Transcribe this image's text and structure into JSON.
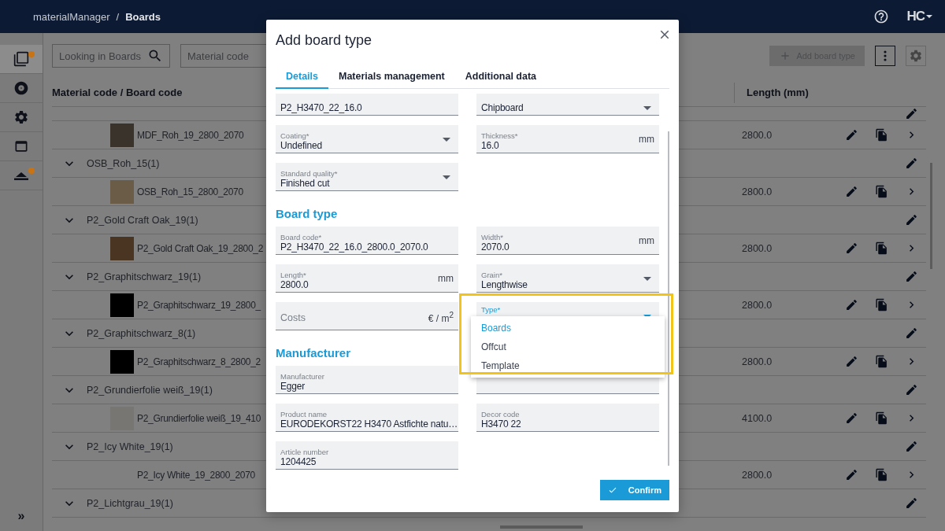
{
  "top_bar": {
    "app": "materialManager",
    "separator": "/",
    "page": "Boards",
    "logo": "HC"
  },
  "sidebar": {
    "items": [
      {
        "selected": true,
        "notification": true
      },
      {
        "selected": false,
        "notification": false
      },
      {
        "selected": false,
        "notification": false
      },
      {
        "selected": false,
        "notification": false
      },
      {
        "selected": false,
        "notification": true
      }
    ],
    "expand": "»"
  },
  "toolbar": {
    "search": {
      "placeholder": "Looking in Boards"
    },
    "filter": {
      "placeholder": "Material code"
    },
    "add_button": {
      "label": "Add board type",
      "disabled": true
    }
  },
  "table": {
    "columns": [
      "Material code / Board code",
      "Length (mm)"
    ],
    "rows": [
      {
        "kind": "partial"
      },
      {
        "kind": "board",
        "name": "MDF_Roh_19_2800_2070",
        "length": "2800.0",
        "color": "#3a332c"
      },
      {
        "kind": "group",
        "name": "OSB_Roh_15(1)",
        "expanded": true
      },
      {
        "kind": "board",
        "name": "OSB_Roh_15_2800_2070",
        "length": "2800.0",
        "color": "#6b5c48"
      },
      {
        "kind": "group",
        "name": "P2_Gold Craft Oak_19(1)",
        "expanded": true
      },
      {
        "kind": "board",
        "name": "P2_Gold Craft Oak_19_2800_2",
        "length": "2800.0",
        "color": "#4a3522"
      },
      {
        "kind": "group",
        "name": "P2_Graphitschwarz_19(1)",
        "expanded": true
      },
      {
        "kind": "board",
        "name": "P2_Graphitschwarz_19_2800_",
        "length": "2800.0",
        "color": "#000000"
      },
      {
        "kind": "group",
        "name": "P2_Graphitschwarz_8(1)",
        "expanded": true
      },
      {
        "kind": "board",
        "name": "P2_Graphitschwarz_8_2800_2",
        "length": "2800.0",
        "color": "#000000"
      },
      {
        "kind": "group",
        "name": "P2_Grundierfolie weiß_19(1)",
        "expanded": true
      },
      {
        "kind": "board",
        "name": "P2_Grundierfolie weiß_19_410",
        "length": "4100.0",
        "color": "#777673"
      },
      {
        "kind": "group",
        "name": "P2_Icy White_19(1)",
        "expanded": true
      },
      {
        "kind": "board",
        "name": "P2_Icy White_19_2800_2070",
        "length": "2800.0"
      },
      {
        "kind": "group",
        "name": "P2_Lichtgrau_19(1)",
        "expanded": true
      }
    ]
  },
  "dialog": {
    "title": "Add board type",
    "tabs": [
      {
        "label": "Details",
        "selected": true
      },
      {
        "label": "Materials management",
        "selected": false
      },
      {
        "label": "Additional data",
        "selected": false
      }
    ],
    "sections": [
      {
        "rows": [
          [
            {
              "kind": "text",
              "value": "P2_H3470_22_16.0"
            },
            {
              "kind": "select",
              "value": "Chipboard"
            }
          ],
          [
            {
              "kind": "select",
              "label": "Coating*",
              "value": "Undefined"
            },
            {
              "kind": "text",
              "label": "Thickness*",
              "value": "16.0",
              "unit": "mm"
            }
          ],
          [
            {
              "kind": "select",
              "label": "Standard quality*",
              "value": "Finished cut"
            }
          ]
        ]
      },
      {
        "heading": "Board type",
        "rows": [
          [
            {
              "kind": "text",
              "label": "Board code*",
              "value": "P2_H3470_22_16.0_2800.0_2070.0"
            },
            {
              "kind": "text",
              "label": "Width*",
              "value": "2070.0",
              "unit": "mm"
            }
          ],
          [
            {
              "kind": "text",
              "label": "Length*",
              "value": "2800.0",
              "unit": "mm"
            },
            {
              "kind": "select",
              "label": "Grain*",
              "value": "Lengthwise"
            }
          ],
          [
            {
              "kind": "text",
              "placeholder": "Costs",
              "unit": "€ / m$^{2}$"
            },
            {
              "kind": "select",
              "label": "Type*",
              "open": true,
              "highlighted": true,
              "options": [
                {
                  "label": "Boards",
                  "selected": true
                },
                {
                  "label": "Offcut",
                  "selected": false
                },
                {
                  "label": "Template",
                  "selected": false
                }
              ]
            }
          ]
        ]
      },
      {
        "heading": "Manufacturer",
        "rows": [
          [
            {
              "kind": "text",
              "label": "Manufacturer",
              "value": "Egger"
            },
            {
              "kind": "text"
            }
          ],
          [
            {
              "kind": "text",
              "label": "Product name",
              "value": "EURODEKORST22 H3470 Astfichte natu…"
            },
            {
              "kind": "text",
              "label": "Decor code",
              "value": "H3470 22"
            }
          ],
          [
            {
              "kind": "text",
              "label": "Article number",
              "value": "1204425"
            }
          ]
        ]
      }
    ],
    "confirm": "Confirm"
  }
}
